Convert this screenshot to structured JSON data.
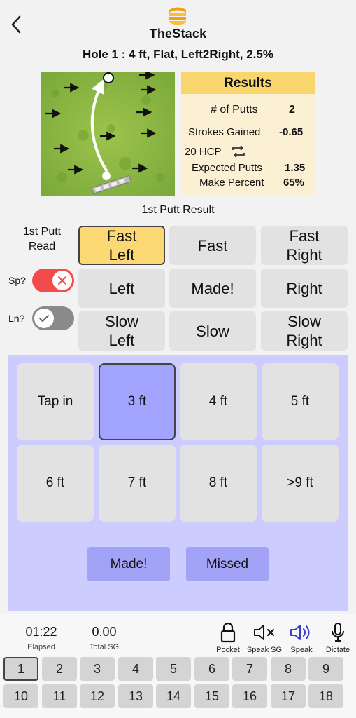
{
  "header": {
    "brand": "TheStack",
    "hole_title": "Hole 1  :  4 ft, Flat, Left2Right, 2.5%"
  },
  "results": {
    "title": "Results",
    "putts_label": "# of Putts",
    "putts_value": "2",
    "sg_label": "Strokes Gained",
    "sg_value": "-0.65",
    "hcp_label": "20 HCP",
    "expected_label": "Expected Putts",
    "expected_value": "1.35",
    "make_label": "Make Percent",
    "make_value": "65%"
  },
  "putt_result_title": "1st Putt Result",
  "read_label": "1st Putt Read",
  "toggles": {
    "speed_label": "Sp?",
    "line_label": "Ln?"
  },
  "directions": [
    [
      "Fast Left",
      "Fast",
      "Fast Right"
    ],
    [
      "Left",
      "Made!",
      "Right"
    ],
    [
      "Slow Left",
      "Slow",
      "Slow Right"
    ]
  ],
  "distances": [
    "Tap in",
    "3 ft",
    "4 ft",
    "5 ft",
    "6 ft",
    "7 ft",
    "8 ft",
    ">9 ft"
  ],
  "actions": {
    "made": "Made!",
    "missed": "Missed"
  },
  "stats": {
    "elapsed_value": "01:22",
    "elapsed_label": "Elapsed",
    "sg_value": "0.00",
    "sg_label": "Total SG"
  },
  "tools": [
    "Pocket",
    "Speak SG",
    "Speak",
    "Dictate"
  ],
  "holes": [
    "1",
    "2",
    "3",
    "4",
    "5",
    "6",
    "7",
    "8",
    "9",
    "10",
    "11",
    "12",
    "13",
    "14",
    "15",
    "16",
    "17",
    "18"
  ],
  "colors": {
    "accent_yellow": "#fcd874",
    "panel_lavender": "#ccccff",
    "selected_blue": "#a2a2ff",
    "toggle_on_red": "#f24b4b",
    "speak_blue": "#3b3bd6"
  }
}
